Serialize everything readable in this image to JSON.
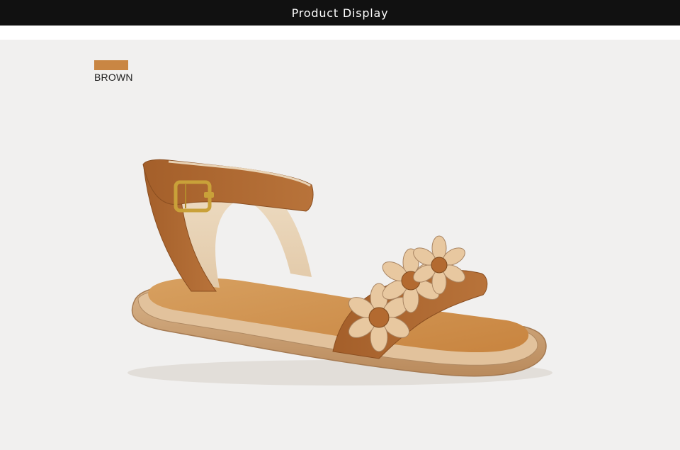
{
  "header": {
    "title": "Product Display"
  },
  "color_option": {
    "label": "BROWN",
    "swatch_color": "#c98643"
  },
  "product_image": {
    "icon": "sandal-image"
  }
}
